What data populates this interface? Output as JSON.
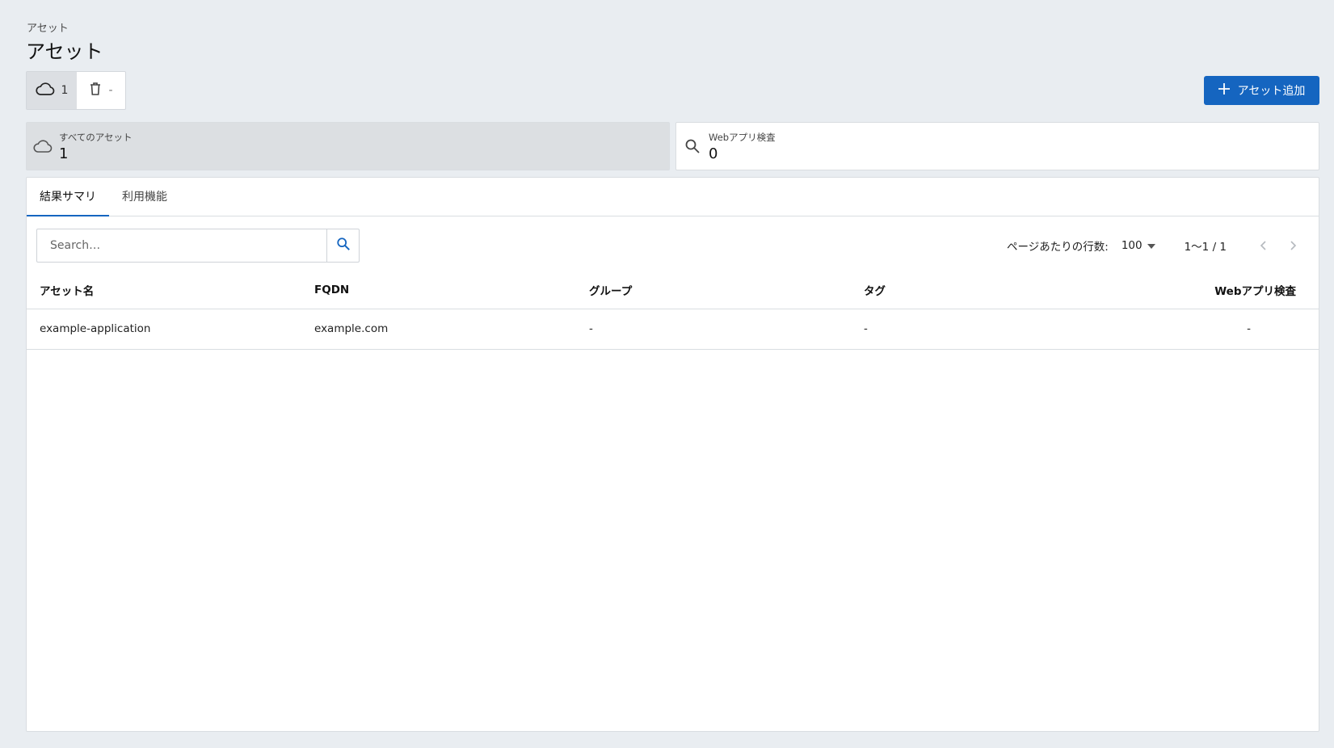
{
  "breadcrumb": "アセット",
  "page_title": "アセット",
  "toggle": {
    "active_count": "1",
    "trash_count": "-"
  },
  "add_button_label": "アセット追加",
  "cards": {
    "all": {
      "label": "すべてのアセット",
      "value": "1"
    },
    "web": {
      "label": "Webアプリ検査",
      "value": "0"
    }
  },
  "tabs": [
    {
      "label": "結果サマリ",
      "active": true
    },
    {
      "label": "利用機能",
      "active": false
    }
  ],
  "search": {
    "placeholder": "Search…",
    "value": ""
  },
  "pager": {
    "rows_label": "ページあたりの行数:",
    "rows_value": "100",
    "range": "1〜1 / 1"
  },
  "table": {
    "columns": [
      "アセット名",
      "FQDN",
      "グループ",
      "タグ",
      "Webアプリ検査"
    ],
    "rows": [
      [
        "example-application",
        "example.com",
        "-",
        "-",
        "-"
      ]
    ]
  },
  "colors": {
    "accent": "#1565c0",
    "background": "#e9edf1"
  },
  "icons": [
    "cloud-icon",
    "trash-icon",
    "plus-icon",
    "search-icon",
    "caret-down-icon",
    "chevron-left-icon",
    "chevron-right-icon"
  ]
}
